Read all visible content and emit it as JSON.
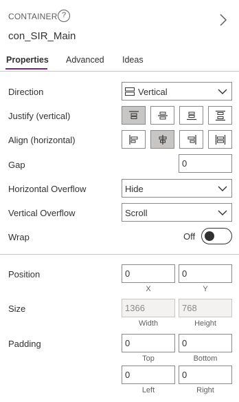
{
  "header": {
    "type_label": "CONTAINER",
    "help_glyph": "?",
    "control_name": "con_SIR_Main"
  },
  "tabs": [
    {
      "label": "Properties",
      "active": true
    },
    {
      "label": "Advanced",
      "active": false
    },
    {
      "label": "Ideas",
      "active": false
    }
  ],
  "layout": {
    "direction": {
      "label": "Direction",
      "value": "Vertical"
    },
    "justify": {
      "label": "Justify (vertical)",
      "selected_index": 0
    },
    "align": {
      "label": "Align (horizontal)",
      "selected_index": 1
    },
    "gap": {
      "label": "Gap",
      "value": "0"
    },
    "horizontal_overflow": {
      "label": "Horizontal Overflow",
      "value": "Hide"
    },
    "vertical_overflow": {
      "label": "Vertical Overflow",
      "value": "Scroll"
    },
    "wrap": {
      "label": "Wrap",
      "state_text": "Off",
      "on": false
    }
  },
  "position": {
    "label": "Position",
    "x": "0",
    "y": "0",
    "x_label": "X",
    "y_label": "Y"
  },
  "size": {
    "label": "Size",
    "width": "1366",
    "height": "768",
    "width_label": "Width",
    "height_label": "Height"
  },
  "padding": {
    "label": "Padding",
    "top": "0",
    "bottom": "0",
    "left": "0",
    "right": "0",
    "top_label": "Top",
    "bottom_label": "Bottom",
    "left_label": "Left",
    "right_label": "Right"
  },
  "colors": {
    "accent": "#742774",
    "selected_segment": "#c8c6c4"
  }
}
